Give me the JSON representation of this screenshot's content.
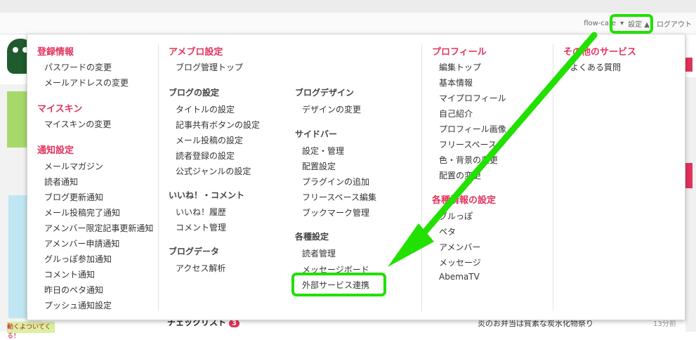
{
  "header": {
    "user": "flow-care",
    "settings_label": "設定",
    "logout_label": "ログアウト"
  },
  "menu": {
    "col1": {
      "cat1": "登録情報",
      "cat1_items": [
        "パスワードの変更",
        "メールアドレスの変更"
      ],
      "cat2": "マイスキン",
      "cat2_items": [
        "マイスキンの変更"
      ],
      "cat3": "通知設定",
      "cat3_items": [
        "メールマガジン",
        "読者通知",
        "ブログ更新通知",
        "メール投稿完了通知",
        "アメンバー限定記事更新通知",
        "アメンバー申請通知",
        "グルっぽ参加通知",
        "コメント通知",
        "昨日のペタ通知",
        "プッシュ通知設定"
      ]
    },
    "col2": {
      "cat1": "アメブロ設定",
      "cat1_items": [
        "ブログ管理トップ"
      ],
      "sub1": "ブログの設定",
      "sub1_items": [
        "タイトルの設定",
        "記事共有ボタンの設定",
        "メール投稿の設定",
        "読者登録の設定",
        "公式ジャンルの設定"
      ],
      "sub2": "いいね！・コメント",
      "sub2_items": [
        "いいね！履歴",
        "コメント管理"
      ],
      "sub3": "ブログデータ",
      "sub3_items": [
        "アクセス解析"
      ]
    },
    "col3": {
      "sub1": "ブログデザイン",
      "sub1_items": [
        "デザインの変更"
      ],
      "sub2": "サイドバー",
      "sub2_items": [
        "設定・管理",
        "配置設定",
        "プラグインの追加",
        "フリースペース編集",
        "ブックマーク管理"
      ],
      "sub3": "各種設定",
      "sub3_items": [
        "読者管理",
        "メッセージボード",
        "外部サービス連携"
      ]
    },
    "col4": {
      "cat1": "プロフィール",
      "cat1_items": [
        "編集トップ",
        "基本情報",
        "マイプロフィール",
        "自己紹介",
        "プロフィール画像",
        "フリースペース",
        "色・背景の変更",
        "配置の変更"
      ],
      "cat2": "各種情報の設定",
      "cat2_items": [
        "グルっぽ",
        "ペタ",
        "アメンバー",
        "メッセージ",
        "AbemaTV"
      ]
    },
    "col5": {
      "cat1": "その他のサービス",
      "cat1_items": [
        "よくある質問"
      ]
    }
  },
  "background": {
    "check_title": "チェックリスト",
    "check_count": "3",
    "news_text": "炎のお弁当は質素な炭水化物祭り",
    "time_text": "13分前",
    "ad_text": "動くよついてくる！"
  },
  "colors": {
    "category": "#e2345f",
    "highlight": "#22e000"
  }
}
